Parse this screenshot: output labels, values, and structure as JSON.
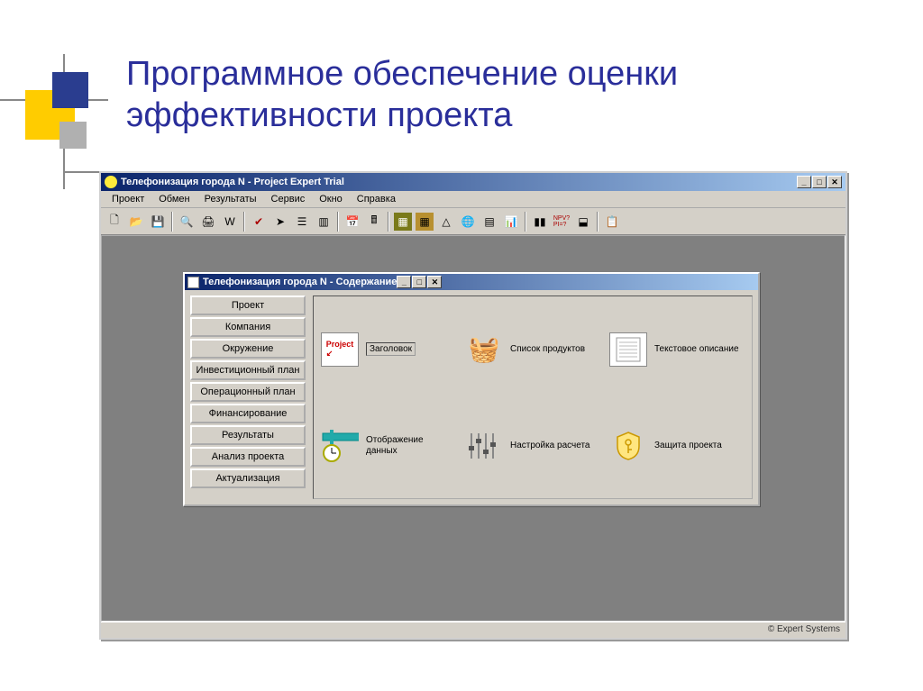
{
  "slide": {
    "title": "Программное обеспечение оценки эффективности проекта"
  },
  "app": {
    "title": "Телефонизация города N - Project Expert Trial",
    "menus": [
      "Проект",
      "Обмен",
      "Результаты",
      "Сервис",
      "Окно",
      "Справка"
    ],
    "status": "© Expert Systems"
  },
  "toolbar_icons": [
    "new",
    "open",
    "save",
    "preview",
    "print-w",
    "word",
    "check",
    "arrow",
    "tree",
    "stack",
    "cal",
    "calc",
    "grid",
    "plus",
    "globe",
    "table",
    "chart",
    "bars",
    "npv",
    "flow",
    "copy"
  ],
  "child": {
    "title": "Телефонизация города N - Содержание",
    "tabs": [
      "Проект",
      "Компания",
      "Окружение",
      "Инвестиционный план",
      "Операционный план",
      "Финансирование",
      "Результаты",
      "Анализ проекта",
      "Актуализация"
    ],
    "items": [
      {
        "icon": "project",
        "label": "Заголовок"
      },
      {
        "icon": "basket",
        "label": "Список продуктов"
      },
      {
        "icon": "doc",
        "label": "Текстовое описание"
      },
      {
        "icon": "clock",
        "label": "Отображение данных"
      },
      {
        "icon": "sliders",
        "label": "Настройка расчета"
      },
      {
        "icon": "shield",
        "label": "Защита проекта"
      }
    ]
  },
  "win_controls": {
    "min": "_",
    "max": "□",
    "close": "✕"
  }
}
